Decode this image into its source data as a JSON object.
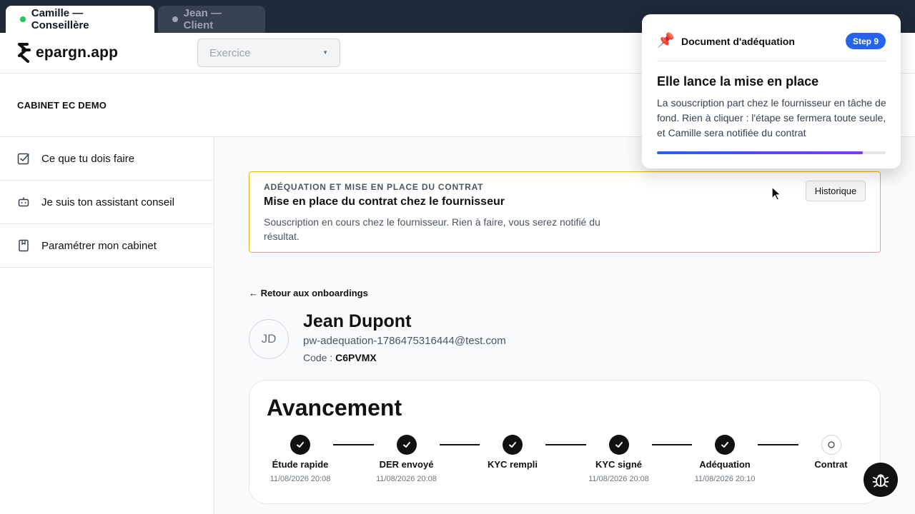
{
  "tabs": [
    {
      "label": "Camille — Conseillère",
      "active": true
    },
    {
      "label": "Jean — Client",
      "active": false
    }
  ],
  "header": {
    "logo_text": "epargn.app",
    "exercise_select": {
      "placeholder": "Exercice"
    }
  },
  "cabinet": {
    "name": "CABINET EC DEMO"
  },
  "sidebar": {
    "items": [
      {
        "label": "Ce que tu dois faire",
        "icon": "checkbox-icon"
      },
      {
        "label": "Je suis ton assistant conseil",
        "icon": "robot-icon"
      },
      {
        "label": "Paramétrer mon cabinet",
        "icon": "book-icon"
      }
    ]
  },
  "banner": {
    "kicker": "Adéquation et mise en place du contrat",
    "title": "Mise en place du contrat chez le fournisseur",
    "description": "Souscription en cours chez le fournisseur. Rien à faire, vous serez notifié du résultat.",
    "history_button": "Historique"
  },
  "back_link": "← Retour aux onboardings",
  "client": {
    "initials": "JD",
    "name": "Jean Dupont",
    "email": "pw-adequation-1786475316444@test.com",
    "code_label": "Code :",
    "code_value": "C6PVMX"
  },
  "progress": {
    "title": "Avancement",
    "steps": [
      {
        "label": "Étude rapide",
        "date": "11/08/2026 20:08",
        "done": true
      },
      {
        "label": "DER envoyé",
        "date": "11/08/2026 20:08",
        "done": true
      },
      {
        "label": "KYC rempli",
        "date": "",
        "done": true
      },
      {
        "label": "KYC signé",
        "date": "11/08/2026 20:08",
        "done": true
      },
      {
        "label": "Adéquation",
        "date": "11/08/2026 20:10",
        "done": true
      },
      {
        "label": "Contrat",
        "date": "",
        "done": false
      }
    ]
  },
  "tour": {
    "pin_icon": "📌",
    "heading": "Document d'adéquation",
    "step_badge": "Step 9",
    "title": "Elle lance la mise en place",
    "body": "La souscription part chez le fournisseur en tâche de fond. Rien à cliquer : l'étape se fermera toute seule, et Camille sera notifiée du contrat",
    "progress_fraction": 0.9
  },
  "colors": {
    "accent": "#2563eb",
    "banner_border": "#eab308",
    "active_dot": "#22c55e"
  }
}
